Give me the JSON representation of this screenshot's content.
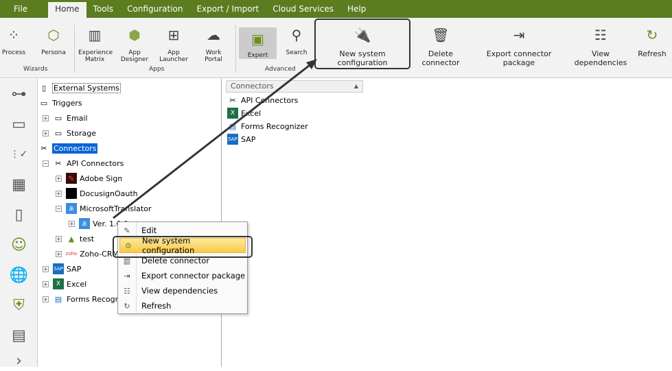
{
  "menu": [
    "File",
    "Home",
    "Tools",
    "Configuration",
    "Export / Import",
    "Cloud Services",
    "Help"
  ],
  "ribbon": {
    "wizards": {
      "label": "Wizards",
      "items": [
        "Process",
        "Persona"
      ]
    },
    "apps": {
      "label": "Apps",
      "items": [
        "Experience Matrix",
        "App Designer",
        "App Launcher",
        "Work Portal"
      ]
    },
    "advanced": {
      "label": "Advanced",
      "items": [
        "Expert",
        "Search"
      ]
    },
    "actions": [
      "New system configuration",
      "Delete connector",
      "Export connector package",
      "View dependencies",
      "Refresh"
    ]
  },
  "tree": [
    "External Systems",
    "Triggers",
    "Email",
    "Storage",
    "Connectors",
    "API Connectors",
    "Adobe Sign",
    "DocusignOauth",
    "MicrosoftTranslator",
    "Ver. 1.0.0",
    "test",
    "Zoho-CRM",
    "SAP",
    "Excel",
    "Forms Recogni"
  ],
  "list": {
    "header": "Connectors",
    "items": [
      "API Connectors",
      "Excel",
      "Forms Recognizer",
      "SAP"
    ]
  },
  "context_menu": [
    "Edit",
    "New system configuration",
    "Delete connector",
    "Export connector package",
    "View dependencies",
    "Refresh"
  ],
  "colors": {
    "menubar": "#5b7c1f",
    "selection": "#0a64d6",
    "highlight": "#f7c94a"
  }
}
